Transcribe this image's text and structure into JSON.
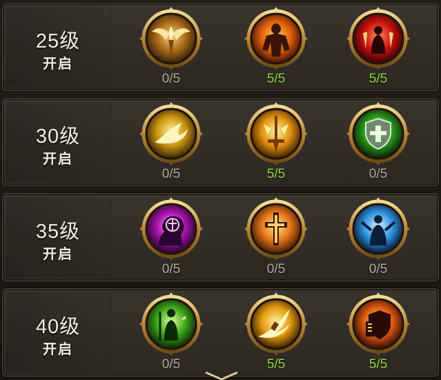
{
  "rows": [
    {
      "level": "25级",
      "unlock": "开启",
      "skills": [
        {
          "icon": "winged-angel-icon",
          "progress": "0/5",
          "done": false,
          "colors": [
            "#f6d37a",
            "#a86a18",
            "#3a230a"
          ]
        },
        {
          "icon": "fire-warrior-icon",
          "progress": "5/5",
          "done": true,
          "colors": [
            "#ffcf4a",
            "#e0600e",
            "#4a1205"
          ]
        },
        {
          "icon": "crimson-monk-icon",
          "progress": "5/5",
          "done": true,
          "colors": [
            "#ff8a5a",
            "#c8120f",
            "#3a0404"
          ]
        }
      ]
    },
    {
      "level": "30级",
      "unlock": "开启",
      "skills": [
        {
          "icon": "golden-phoenix-icon",
          "progress": "0/5",
          "done": false,
          "colors": [
            "#fff19a",
            "#c99410",
            "#3d2a05"
          ]
        },
        {
          "icon": "holy-sword-icon",
          "progress": "5/5",
          "done": true,
          "colors": [
            "#fff2a0",
            "#e0900f",
            "#4a2605"
          ]
        },
        {
          "icon": "green-shield-icon",
          "progress": "0/5",
          "done": false,
          "colors": [
            "#c8ff8a",
            "#2c9a1c",
            "#08270a"
          ]
        }
      ]
    },
    {
      "level": "35级",
      "unlock": "开启",
      "skills": [
        {
          "icon": "mind-sigil-icon",
          "progress": "0/5",
          "done": false,
          "colors": [
            "#ff9af5",
            "#a412a8",
            "#2a0530"
          ]
        },
        {
          "icon": "flaming-cross-icon",
          "progress": "0/5",
          "done": false,
          "colors": [
            "#ffe88a",
            "#e4741a",
            "#4a1d05"
          ]
        },
        {
          "icon": "blue-prophet-icon",
          "progress": "0/5",
          "done": false,
          "colors": [
            "#d9f6ff",
            "#2e93e0",
            "#061c3a"
          ]
        }
      ]
    },
    {
      "level": "40级",
      "unlock": "开启",
      "skills": [
        {
          "icon": "nature-priest-icon",
          "progress": "0/5",
          "done": false,
          "colors": [
            "#d8ff9a",
            "#3ea51a",
            "#0a2a06"
          ]
        },
        {
          "icon": "comet-strike-icon",
          "progress": "5/5",
          "done": true,
          "colors": [
            "#fff19a",
            "#e29a10",
            "#3d2305"
          ]
        },
        {
          "icon": "fire-shield-icon",
          "progress": "5/5",
          "done": true,
          "colors": [
            "#ffd26a",
            "#dd5a10",
            "#3d0f04"
          ]
        }
      ]
    }
  ],
  "colors": {
    "progress_incomplete": "#b3aca4",
    "progress_complete": "#8fdb3a",
    "frame_gold": "#c9a052"
  }
}
